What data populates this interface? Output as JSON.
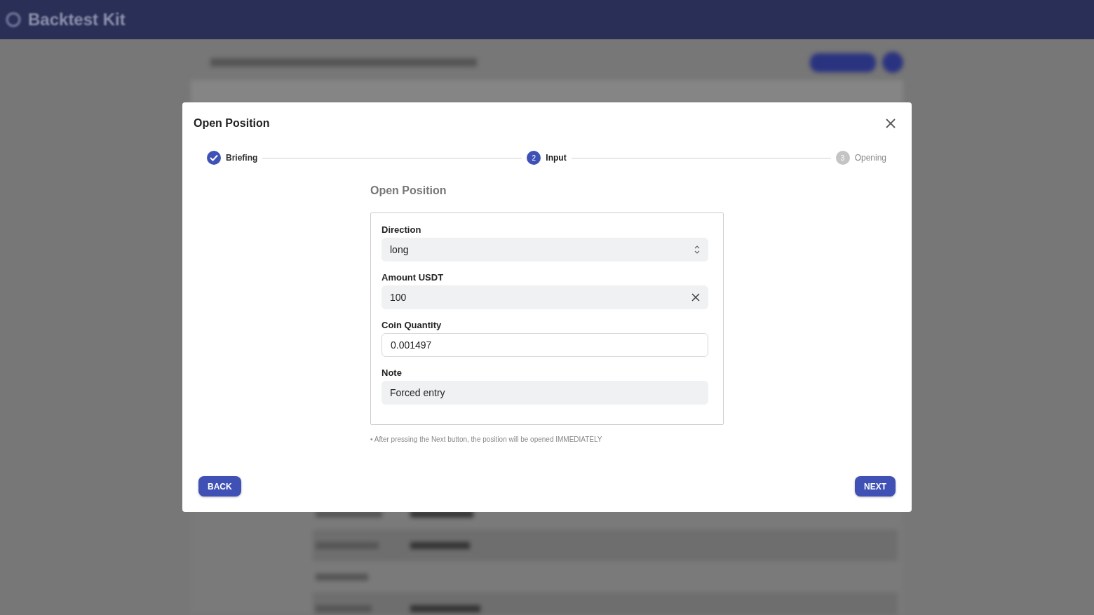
{
  "app_bar": {
    "title": "Backtest Kit"
  },
  "dialog": {
    "title": "Open Position",
    "steps": [
      {
        "label": "Briefing",
        "completed": true,
        "selected": false
      },
      {
        "label": "Input",
        "number": "2",
        "completed": false,
        "selected": true
      },
      {
        "label": "Opening",
        "number": "3",
        "completed": false,
        "selected": false
      }
    ],
    "form_title": "Open Position",
    "fields": [
      {
        "label": "Direction",
        "value": "long",
        "kind": "select"
      },
      {
        "label": "Amount USDT",
        "value": "100",
        "kind": "clearable"
      },
      {
        "label": "Coin Quantity",
        "value": "0.001497",
        "kind": "outlined"
      },
      {
        "label": "Note",
        "value": "Forced entry",
        "kind": "filled"
      }
    ],
    "hint": "• After pressing the Next button, the position will be opened IMMEDIATELY",
    "buttons": [
      {
        "label": "BACK"
      },
      {
        "label": "NEXT"
      }
    ]
  }
}
